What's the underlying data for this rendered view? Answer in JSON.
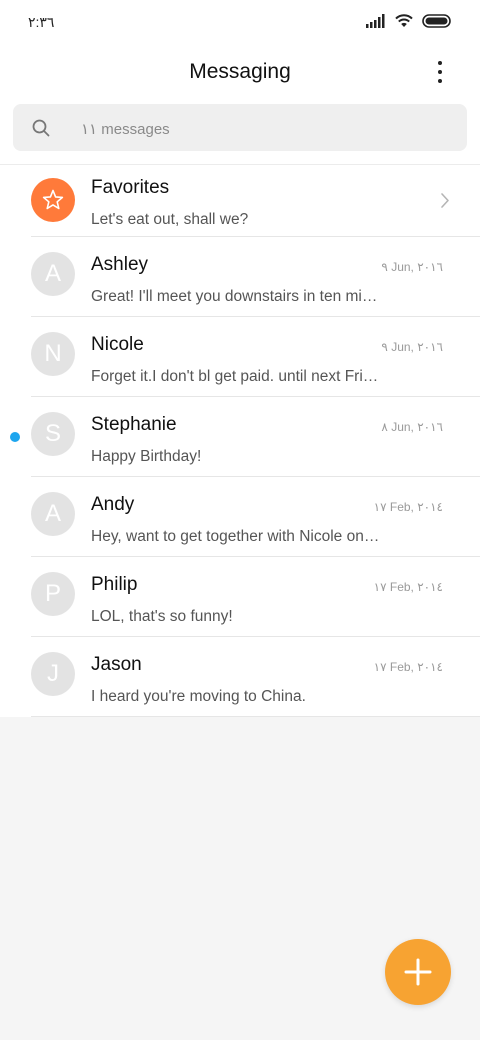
{
  "status_bar": {
    "time": "٢:٣٦",
    "icons": [
      "cellular-signal-icon",
      "wifi-icon",
      "battery-icon"
    ]
  },
  "header": {
    "title": "Messaging",
    "menu_icon": "more-vertical-icon"
  },
  "search": {
    "icon": "search-icon",
    "placeholder": "١١ messages"
  },
  "favorites": {
    "name": "Favorites",
    "preview": "Let's eat out, shall we?",
    "icon": "star-icon",
    "accent_color": "#ff7a3a"
  },
  "conversations": [
    {
      "initial": "A",
      "name": "Ashley",
      "date": "٩ Jun, ٢٠١٦",
      "preview": "Great! I'll meet you downstairs in ten mi…",
      "unread": false
    },
    {
      "initial": "N",
      "name": "Nicole",
      "date": "٩ Jun, ٢٠١٦",
      "preview": "Forget it.I don't bl get paid. until next Fri…",
      "unread": false
    },
    {
      "initial": "S",
      "name": "Stephanie",
      "date": "٨ Jun, ٢٠١٦",
      "preview": "Happy Birthday!",
      "unread": true
    },
    {
      "initial": "A",
      "name": "Andy",
      "date": "١٧ Feb, ٢٠١٤",
      "preview": "Hey, want to get together with Nicole on…",
      "unread": false
    },
    {
      "initial": "P",
      "name": "Philip",
      "date": "١٧ Feb, ٢٠١٤",
      "preview": "LOL, that's so funny!",
      "unread": false
    },
    {
      "initial": "J",
      "name": "Jason",
      "date": "١٧ Feb, ٢٠١٤",
      "preview": "I heard you're moving to China.",
      "unread": false
    }
  ],
  "fab": {
    "icon": "plus-icon",
    "color": "#f7a332"
  },
  "colors": {
    "unread_dot": "#1da5ee",
    "avatar_bg": "#e3e3e3"
  }
}
